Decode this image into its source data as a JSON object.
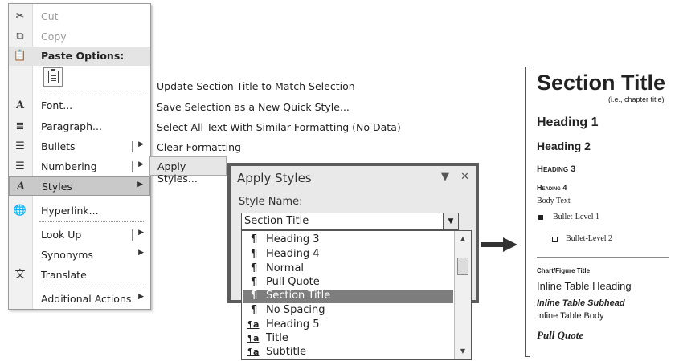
{
  "context_menu": {
    "items": [
      {
        "label": "Cut",
        "icon": "scissors-icon",
        "disabled": true
      },
      {
        "label": "Copy",
        "icon": "copy-icon",
        "disabled": true
      },
      {
        "label": "Paste Options:",
        "icon": "paste-icon"
      },
      {
        "label": "Font...",
        "icon": "font-icon"
      },
      {
        "label": "Paragraph...",
        "icon": "paragraph-icon"
      },
      {
        "label": "Bullets",
        "icon": "bullets-icon"
      },
      {
        "label": "Numbering",
        "icon": "numbering-icon"
      },
      {
        "label": "Styles",
        "icon": "styles-icon"
      },
      {
        "label": "Hyperlink...",
        "icon": "hyperlink-icon"
      },
      {
        "label": "Look Up"
      },
      {
        "label": "Synonyms"
      },
      {
        "label": "Translate",
        "icon": "translate-icon"
      },
      {
        "label": "Additional Actions"
      }
    ]
  },
  "styles_submenu": {
    "items": [
      "Update Section Title to Match Selection",
      "Save Selection as a New Quick Style...",
      "Select All Text With Similar Formatting (No Data)",
      "Clear Formatting",
      "Apply Styles..."
    ]
  },
  "apply_styles_pane": {
    "title": "Apply Styles",
    "style_name_label": "Style Name:",
    "style_name_value": "Section Title",
    "list": [
      {
        "mark": "¶",
        "label": "Heading 3"
      },
      {
        "mark": "¶",
        "label": "Heading 4"
      },
      {
        "mark": "¶",
        "label": "Normal"
      },
      {
        "mark": "¶",
        "label": "Pull Quote"
      },
      {
        "mark": "¶",
        "label": "Section Title",
        "selected": true
      },
      {
        "mark": "¶",
        "label": "No Spacing"
      },
      {
        "mark": "¶a",
        "label": "Heading 5"
      },
      {
        "mark": "¶a",
        "label": "Title"
      },
      {
        "mark": "¶a",
        "label": "Subtitle"
      }
    ]
  },
  "style_preview": {
    "section_title": "Section Title",
    "section_note": "(i.e., chapter title)",
    "heading1": "Heading 1",
    "heading2": "Heading 2",
    "heading3": "Heading 3",
    "heading4": "Heading 4",
    "body_text": "Body Text",
    "bullet1": "Bullet-Level 1",
    "bullet2": "Bullet-Level 2",
    "chart_title": "Chart/Figure Title",
    "inline_table_heading": "Inline Table Heading",
    "inline_table_subhead": "Inline Table Subhead",
    "inline_table_body": "Inline Table Body",
    "pull_quote": "Pull Quote"
  }
}
